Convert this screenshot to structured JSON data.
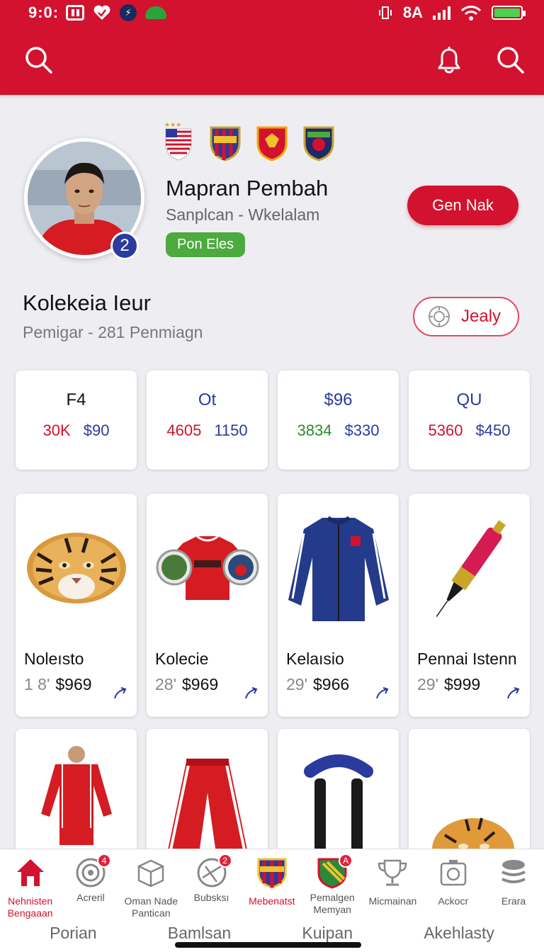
{
  "status_bar": {
    "time": "9:0:",
    "carrier": "8A"
  },
  "colors": {
    "primary": "#d2122e",
    "green": "#4caa3e",
    "blue": "#2b3a9e"
  },
  "profile": {
    "name": "Mapran Pembah",
    "subtitle": "Sanplcan  -  Wkelalam",
    "tag": "Pon Eles",
    "badge_number": "2",
    "cta_label": "Gen Nak"
  },
  "collection": {
    "title": "Kolekeia Ieur",
    "subtitle": "Pemigar - 281 Penmiagn",
    "button_label": "Jealy"
  },
  "stats": [
    {
      "title": "F4",
      "a": "30K",
      "b": "$90",
      "title_color": "#111",
      "a_color": "#d2122e",
      "b_color": "#2b3a9e"
    },
    {
      "title": "Ot",
      "a": "4605",
      "b": "1150",
      "title_color": "#2b3a9e",
      "a_color": "#d2122e",
      "b_color": "#2b3a9e"
    },
    {
      "title": "$96",
      "a": "3834",
      "b": "$330",
      "title_color": "#2b3a9e",
      "a_color": "#2a8a2a",
      "b_color": "#2b3a9e"
    },
    {
      "title": "QU",
      "a": "5360",
      "b": "$450",
      "title_color": "#2b3a9e",
      "a_color": "#d2122e",
      "b_color": "#2b3a9e"
    }
  ],
  "products": [
    {
      "name": "Noleısto",
      "qty": "1 8'",
      "price": "$969",
      "icon": "tiger-rug-icon"
    },
    {
      "name": "Kolecie",
      "qty": "28'",
      "price": "$969",
      "icon": "red-jersey-icon"
    },
    {
      "name": "Kelaısio",
      "qty": "29'",
      "price": "$966",
      "icon": "blue-jacket-icon"
    },
    {
      "name": "Pennai Istenn",
      "qty": "29'",
      "price": "$999",
      "icon": "pen-icon"
    }
  ],
  "products_row2": [
    {
      "icon": "red-kit-icon"
    },
    {
      "icon": "red-pants-icon"
    },
    {
      "icon": "handle-bar-icon"
    },
    {
      "icon": "tiger-head-icon"
    }
  ],
  "bottom_tabs": [
    {
      "label": "Nehnisten\nBengaaan",
      "icon": "home-icon",
      "badge": ""
    },
    {
      "label": "Acreril",
      "icon": "target-icon",
      "badge": "4"
    },
    {
      "label": "Oman Nade\nPantican",
      "icon": "box-icon",
      "badge": ""
    },
    {
      "label": "Bubsksı",
      "icon": "ball-icon",
      "badge": "2"
    },
    {
      "label": "Mebenatst",
      "icon": "crest-icon",
      "badge": ""
    },
    {
      "label": "Pemalgen\nMemyan",
      "icon": "shield-icon",
      "badge": "A"
    },
    {
      "label": "Micmainan",
      "icon": "trophy-icon",
      "badge": ""
    },
    {
      "label": "Ackocr",
      "icon": "camera-icon",
      "badge": ""
    },
    {
      "label": "Erara",
      "icon": "stack-icon",
      "badge": ""
    }
  ],
  "bottom_labels": [
    "Porian",
    "Bamlsan",
    "Kuipan",
    "Akehlasty"
  ]
}
